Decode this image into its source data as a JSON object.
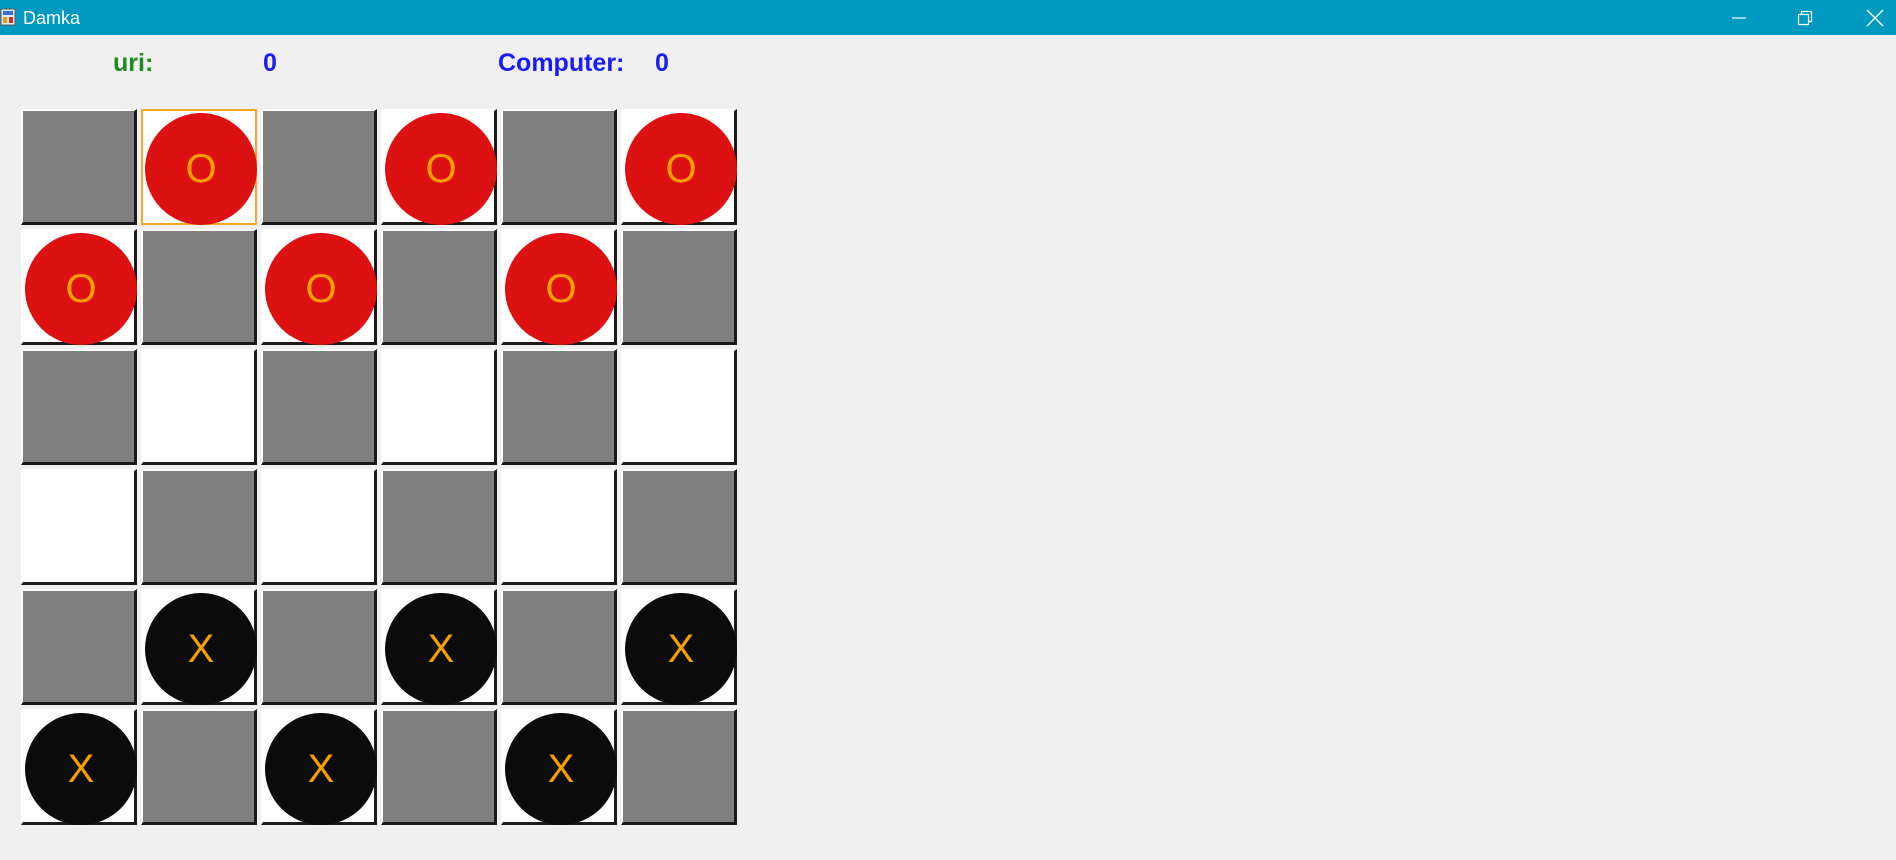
{
  "window": {
    "title": "Damka",
    "titlebar_color": "#0099bf",
    "icons": {
      "app": "app-icon",
      "minimize": "minimize-icon",
      "restore": "restore-icon",
      "close": "close-icon"
    }
  },
  "score": {
    "player_label": "uri:",
    "player_score": "0",
    "computer_label": "Computer:",
    "computer_score": "0",
    "player_label_color": "#1f8a1f",
    "score_color": "#1a1aff"
  },
  "board": {
    "size": 6,
    "dark_color": "#808080",
    "light_color": "#ffffff",
    "selected": [
      0,
      1
    ],
    "pieces": {
      "O": {
        "symbol": "O",
        "fill": "#dd1111",
        "text": "#f5a000"
      },
      "X": {
        "symbol": "X",
        "fill": "#0c0c0c",
        "text": "#f5a000"
      }
    },
    "rows": [
      [
        "",
        "O",
        "",
        "O",
        "",
        "O"
      ],
      [
        "O",
        "",
        "O",
        "",
        "O",
        ""
      ],
      [
        "",
        "",
        "",
        "",
        "",
        ""
      ],
      [
        "",
        "",
        "",
        "",
        "",
        ""
      ],
      [
        "",
        "X",
        "",
        "X",
        "",
        "X"
      ],
      [
        "X",
        "",
        "X",
        "",
        "X",
        ""
      ]
    ]
  }
}
